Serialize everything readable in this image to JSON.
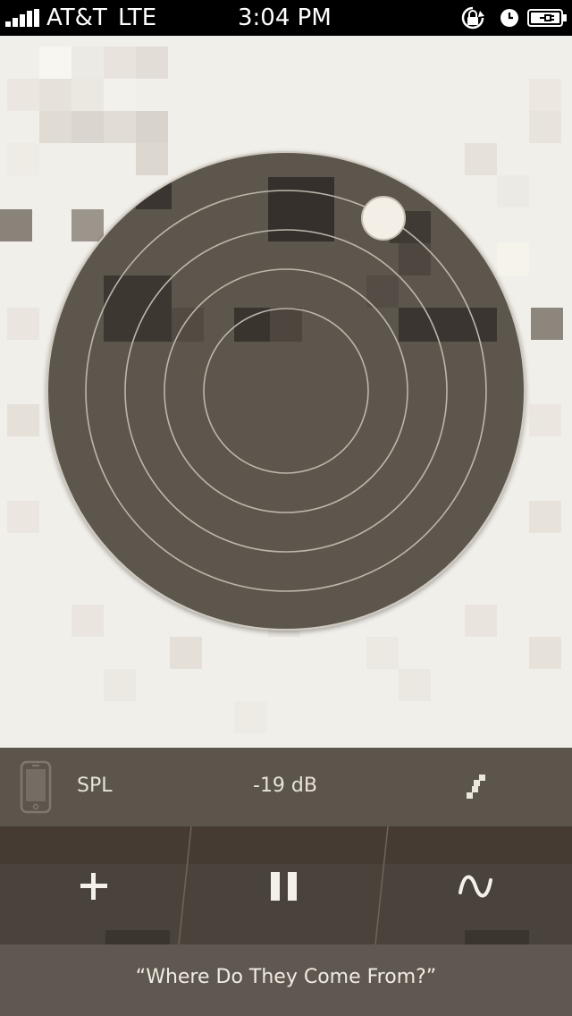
{
  "status_bar": {
    "carrier": "AT&T",
    "network": "LTE",
    "time": "3:04 PM",
    "icons": [
      "orientation-lock-icon",
      "alarm-clock-icon",
      "battery-charging-icon"
    ]
  },
  "meter": {
    "label": "SPL",
    "value": "-19 dB",
    "device_icon": "iphone-icon",
    "settings_icon": "signal-path-icon"
  },
  "controls": {
    "add_icon": "plus-icon",
    "pause_icon": "pause-icon",
    "wave_icon": "sine-wave-icon"
  },
  "song": {
    "title": "“Where Do They Come From?”"
  },
  "colors": {
    "background": "#f1efea",
    "radar": "#5c564d",
    "info_bar": "#5c554c",
    "controls": "#4a433b",
    "marker": "#f3efe6"
  }
}
